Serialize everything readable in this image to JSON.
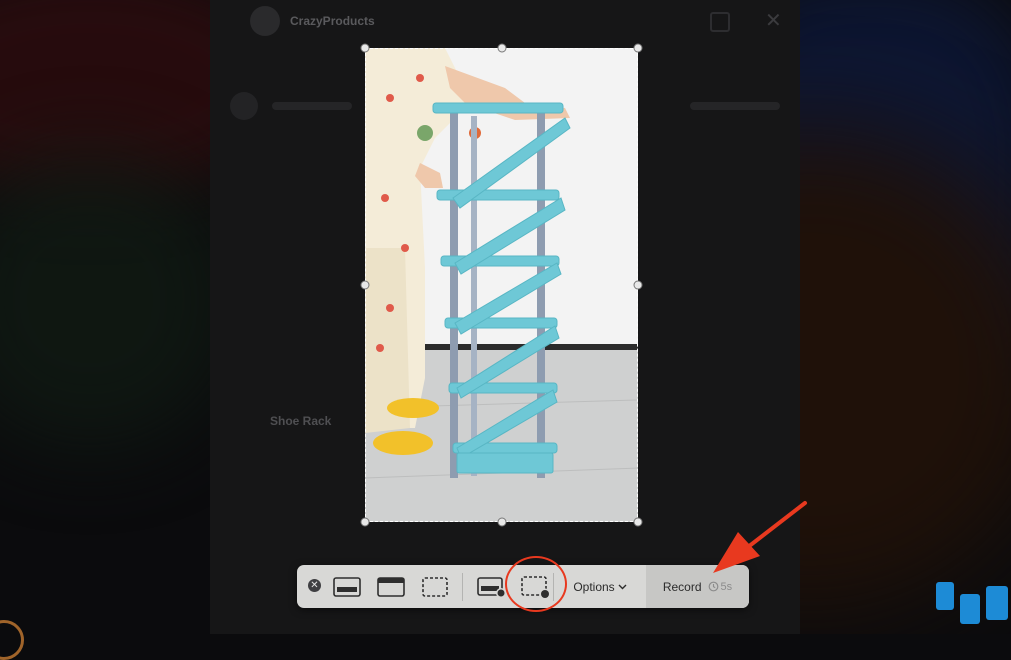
{
  "background_post": {
    "page_name": "CrazyProducts",
    "shoe_rack_text": "Shoe Rack"
  },
  "toolbar": {
    "options_label": "Options",
    "record_label": "Record",
    "timer_label": "5s"
  },
  "icons": {
    "close": "close-icon",
    "capture_window": "capture-window-icon",
    "capture_entire_screen": "capture-entire-screen-icon",
    "capture_selection": "capture-selection-icon",
    "record_entire_screen": "record-entire-screen-icon",
    "record_selection": "record-selection-icon",
    "timer": "timer-icon",
    "chevron_down": "chevron-down-icon"
  },
  "colors": {
    "annotation_red": "#e8391f",
    "toolbar_bg": "#d8d8d6",
    "rack_blue": "#6ec8d6"
  }
}
